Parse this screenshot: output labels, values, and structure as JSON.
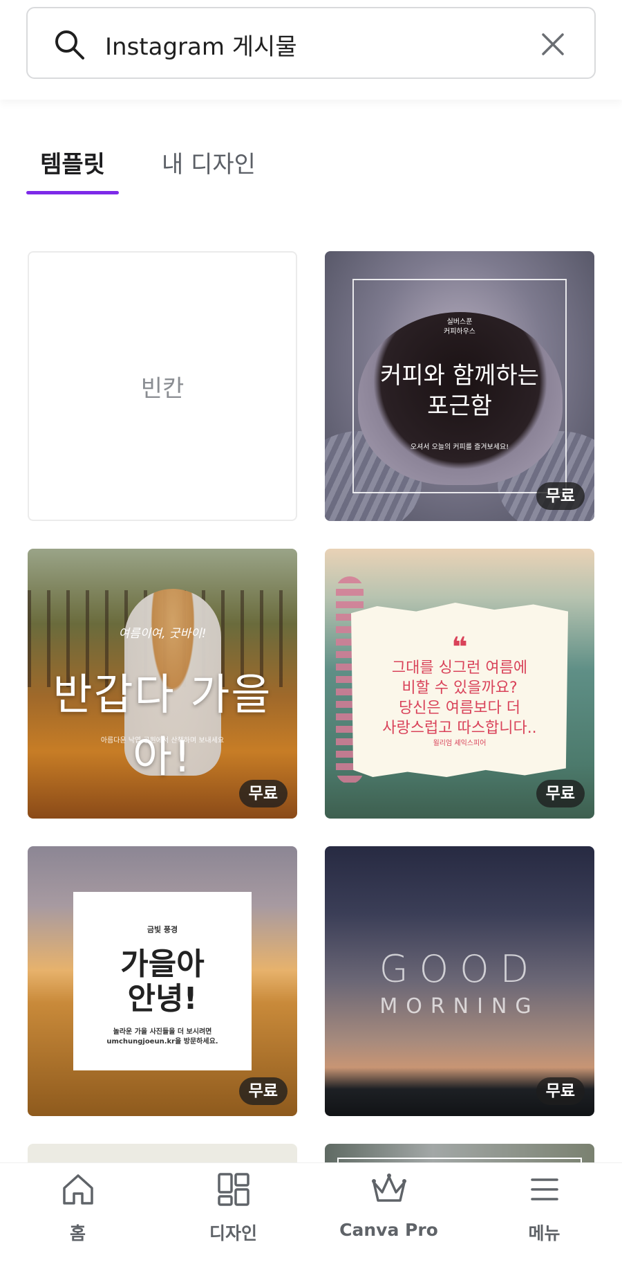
{
  "search": {
    "value": "Instagram 게시물",
    "search_icon": "search-icon",
    "clear_icon": "close-icon"
  },
  "tabs": [
    {
      "label": "템플릿",
      "active": true
    },
    {
      "label": "내 디자인",
      "active": false
    }
  ],
  "accent_color": "#7d2ae8",
  "cards": {
    "blank": {
      "label": "빈칸"
    },
    "coffee": {
      "brand": "실버스푼",
      "brand_sub": "커피하우스",
      "headline_1": "커피와 함께하는",
      "headline_2": "포근함",
      "subtitle": "오셔서 오늘의 커피를 즐겨보세요!",
      "badge": "무료"
    },
    "autumn": {
      "script": "여름이여, 굿바이!",
      "headline": "반갑다 가을아!",
      "subtitle": "아름다운 낙엽 공원에서 산책하며 보내세요",
      "badge": "무료"
    },
    "quote": {
      "mark": "❝",
      "line_1": "그대를 싱그런 여름에",
      "line_2": "비할 수 있을까요?",
      "line_3": "당신은 여름보다 더",
      "line_4": "사랑스럽고 따스합니다..",
      "author": "윌리엄 셰익스피어",
      "badge": "무료"
    },
    "field": {
      "small": "금빛 풍경",
      "headline_1": "가을아",
      "headline_2": "안녕!",
      "sub_1": "놀라운 가을 사진들을 더 보시려면",
      "sub_2": "umchungjoeun.kr을 방문하세요.",
      "badge": "무료"
    },
    "morning": {
      "line_1": "GOOD",
      "line_2": "MORNING",
      "badge": "무료"
    }
  },
  "bottom_nav": [
    {
      "label": "홈",
      "icon": "home-icon"
    },
    {
      "label": "디자인",
      "icon": "grid-icon"
    },
    {
      "label": "Canva Pro",
      "icon": "crown-icon"
    },
    {
      "label": "메뉴",
      "icon": "menu-icon"
    }
  ]
}
